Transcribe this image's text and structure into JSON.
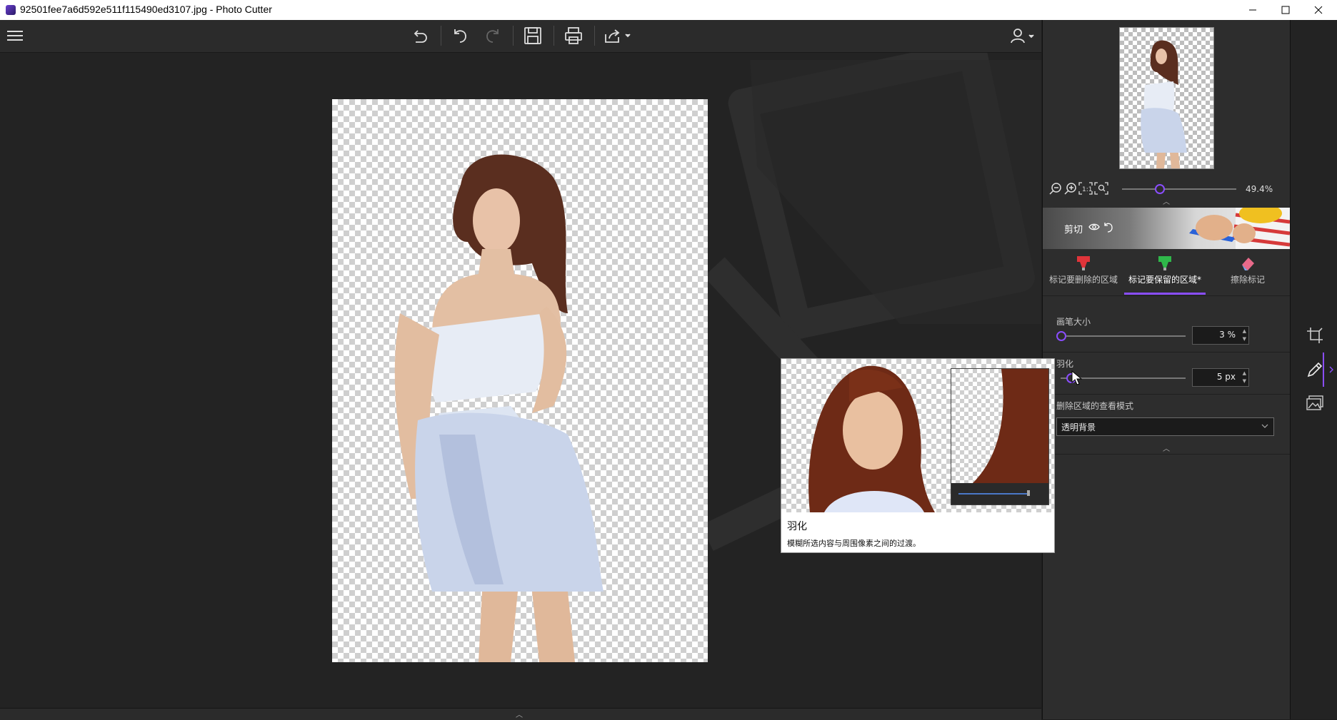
{
  "window": {
    "title": "92501fee7a6d592e511f115490ed3107.jpg - Photo Cutter"
  },
  "zoom": {
    "value_label": "49.4%",
    "slider_fraction": 0.3
  },
  "cut_section": {
    "label": "剪切"
  },
  "tools": [
    {
      "label": "标记要删除的区域",
      "icon": "red-marker-icon",
      "color": "#e0343a"
    },
    {
      "label": "标记要保留的区域*",
      "icon": "green-marker-icon",
      "color": "#2fb84a"
    },
    {
      "label": "擦除标记",
      "icon": "eraser-icon",
      "color": "#e86a8a"
    }
  ],
  "active_tool_index": 1,
  "settings": {
    "brush_size": {
      "label": "画笔大小",
      "value": "3 %",
      "fraction": 0.03
    },
    "feather": {
      "label": "羽化",
      "value": "5 px",
      "fraction": 0.08
    },
    "view_mode": {
      "label": "删除区域的查看模式",
      "value": "透明背景"
    }
  },
  "tooltip": {
    "title": "羽化",
    "description": "模糊所选内容与周围像素之间的过渡。"
  },
  "colors": {
    "accent": "#8a4dff",
    "panel_bg": "#2d2d2d",
    "canvas_bg": "#232323"
  }
}
